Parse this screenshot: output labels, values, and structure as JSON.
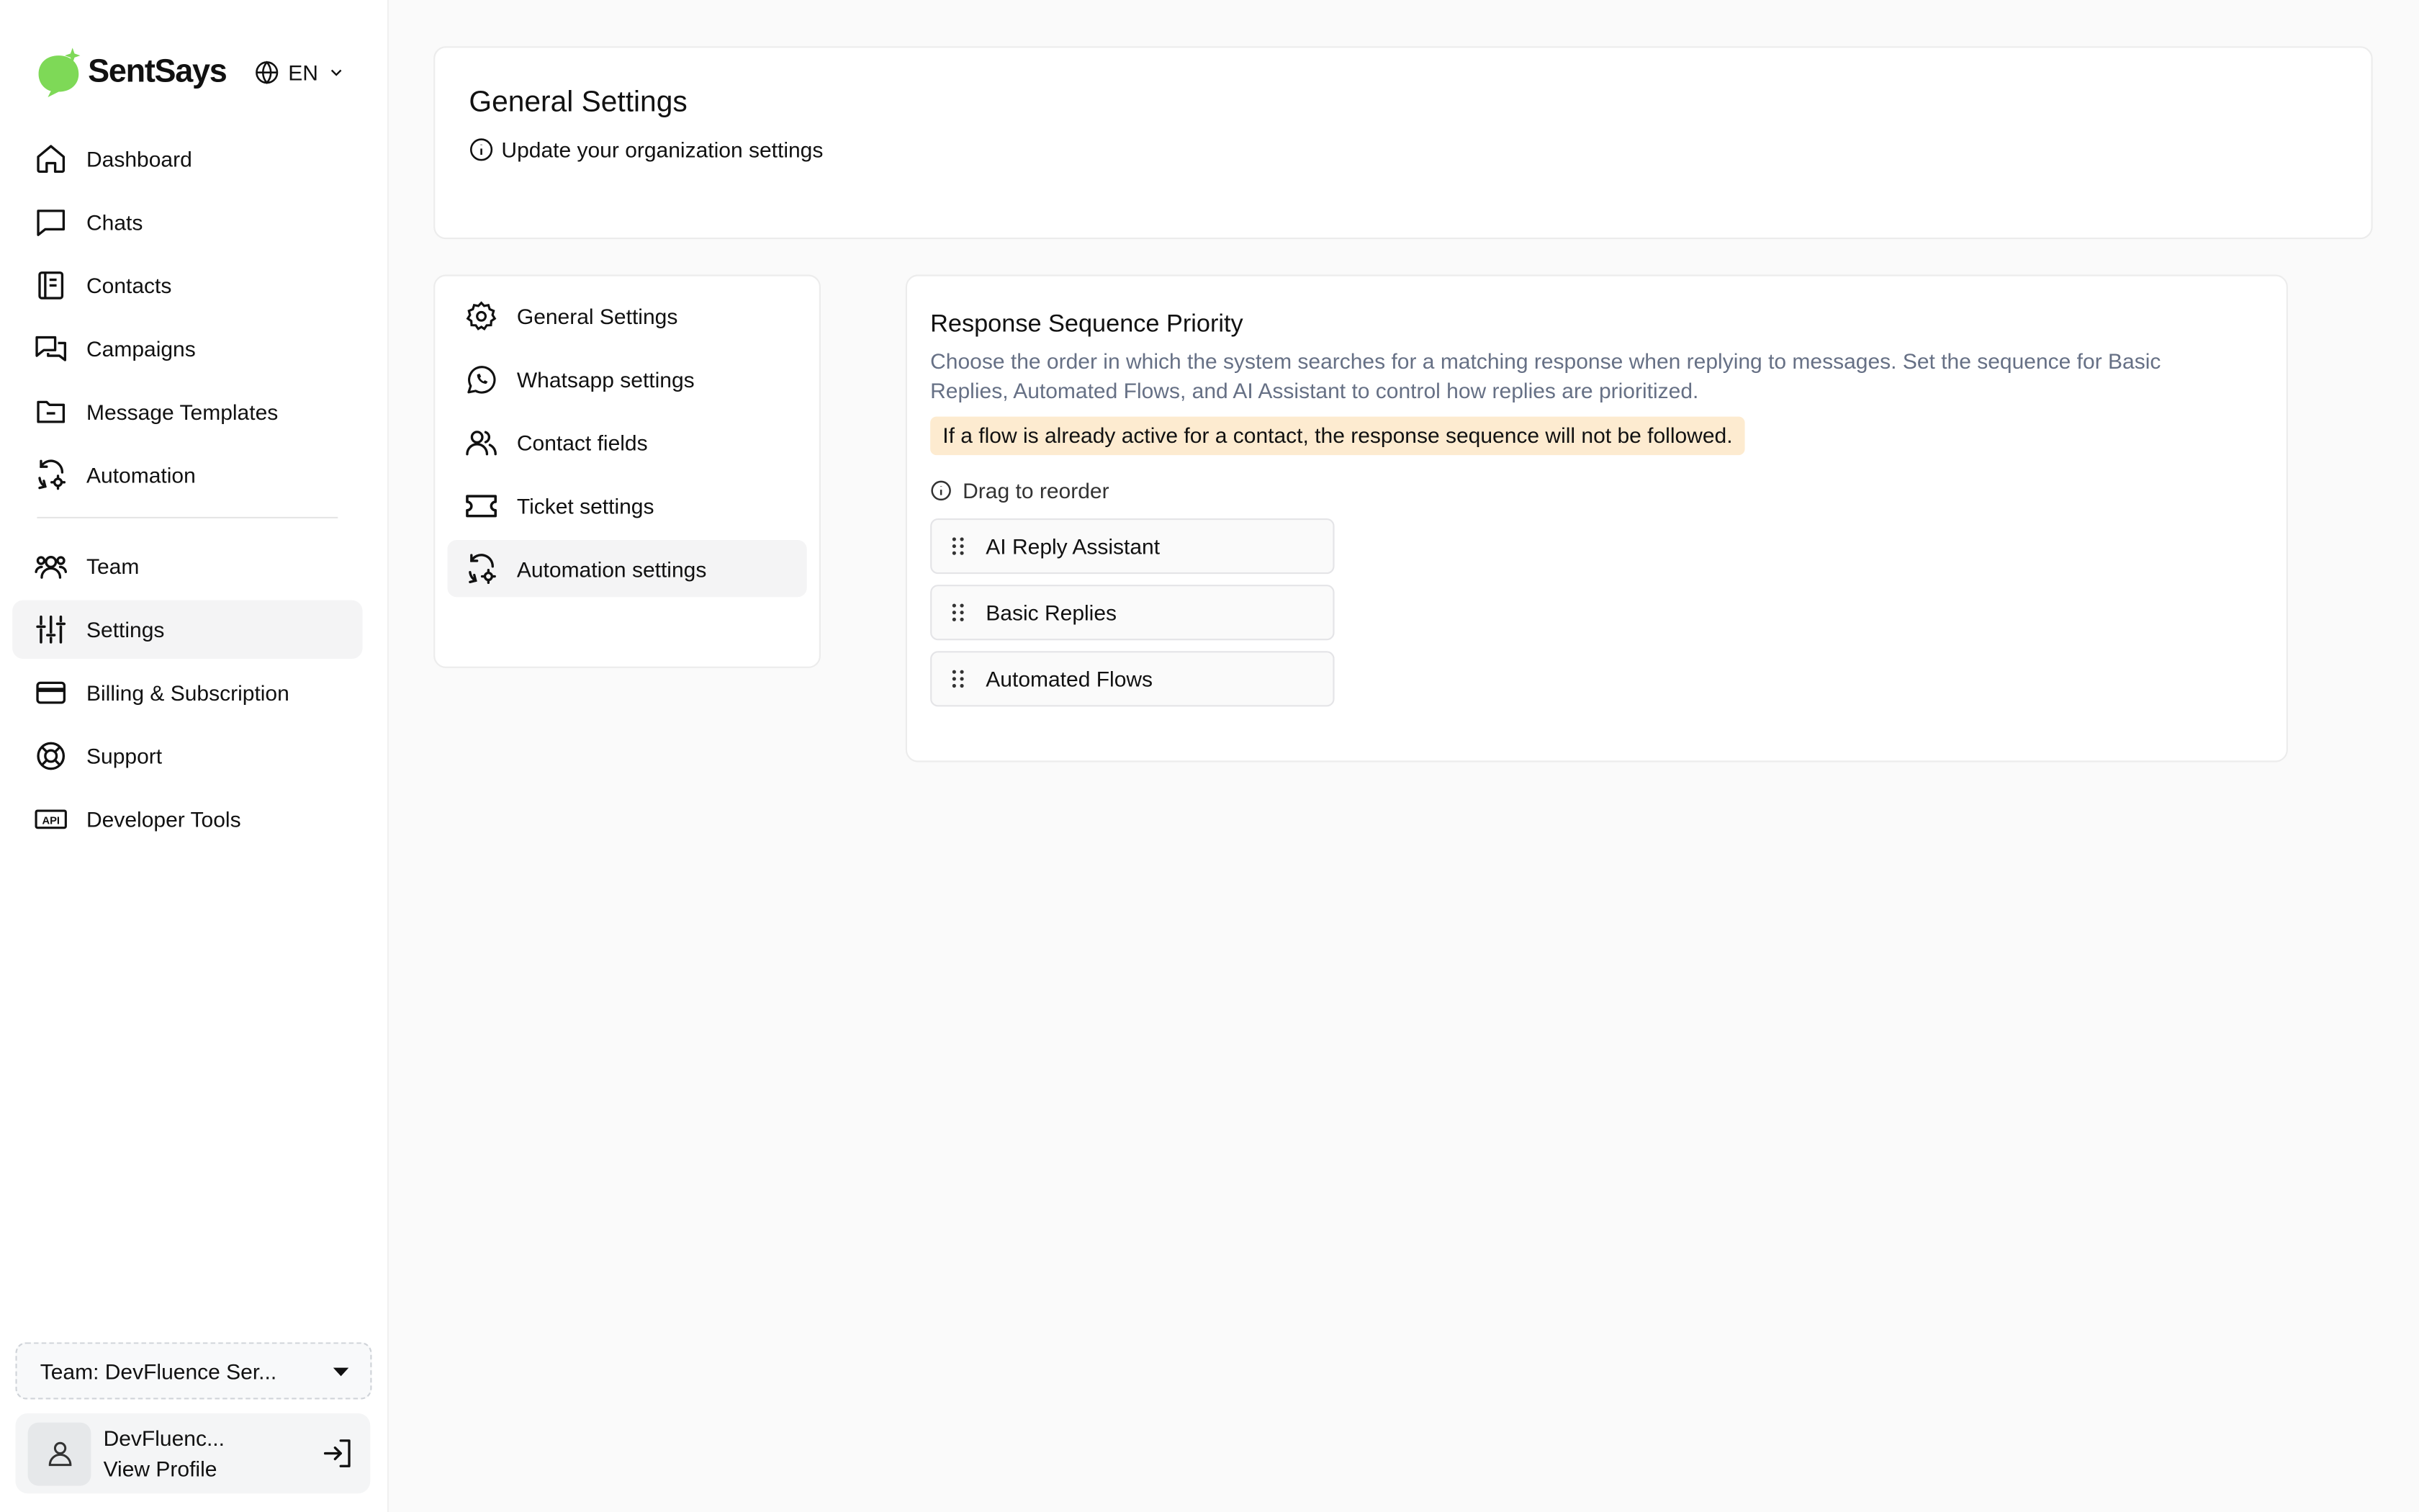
{
  "app": {
    "name": "SentSays",
    "language": "EN"
  },
  "sidebar": {
    "items": [
      {
        "label": "Dashboard",
        "icon": "home-icon"
      },
      {
        "label": "Chats",
        "icon": "chat-icon"
      },
      {
        "label": "Contacts",
        "icon": "contacts-book-icon"
      },
      {
        "label": "Campaigns",
        "icon": "campaigns-icon"
      },
      {
        "label": "Message Templates",
        "icon": "folder-icon"
      },
      {
        "label": "Automation",
        "icon": "automation-icon"
      },
      {
        "label": "Team",
        "icon": "team-icon"
      },
      {
        "label": "Settings",
        "icon": "sliders-icon",
        "active": true
      },
      {
        "label": "Billing & Subscription",
        "icon": "credit-card-icon"
      },
      {
        "label": "Support",
        "icon": "lifebuoy-icon"
      },
      {
        "label": "Developer Tools",
        "icon": "api-icon"
      }
    ],
    "team_select": "Team: DevFluence Ser...",
    "profile": {
      "name": "DevFluenc...",
      "link": "View Profile"
    }
  },
  "header": {
    "title": "General Settings",
    "subtitle": "Update your organization settings"
  },
  "settings_menu": {
    "items": [
      {
        "label": "General Settings",
        "icon": "gear-icon"
      },
      {
        "label": "Whatsapp settings",
        "icon": "whatsapp-icon"
      },
      {
        "label": "Contact fields",
        "icon": "users-icon"
      },
      {
        "label": "Ticket settings",
        "icon": "ticket-icon"
      },
      {
        "label": "Automation settings",
        "icon": "automation-icon",
        "active": true
      }
    ]
  },
  "content": {
    "title": "Response Sequence Priority",
    "description": "Choose the order in which the system searches for a matching response when replying to messages. Set the sequence for Basic Replies, Automated Flows, and AI Assistant to control how replies are prioritized.",
    "warning": "If a flow is already active for a contact, the response sequence will not be followed.",
    "drag_hint": "Drag to reorder",
    "sequence": [
      "AI Reply Assistant",
      "Basic Replies",
      "Automated Flows"
    ]
  },
  "colors": {
    "brand_green": "#7ed957",
    "warning_bg": "#fdebd0",
    "active_bg": "#f4f4f5"
  }
}
